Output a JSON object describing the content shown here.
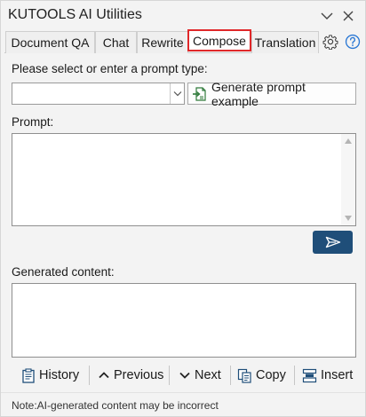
{
  "window": {
    "title": "KUTOOLS AI Utilities"
  },
  "tabs": [
    {
      "label": "Document QA",
      "active": false
    },
    {
      "label": "Chat",
      "active": false
    },
    {
      "label": "Rewrite",
      "active": false
    },
    {
      "label": "Compose",
      "active": true
    },
    {
      "label": "Translation",
      "active": false
    }
  ],
  "tab_icons": [
    "gear-icon",
    "help-icon"
  ],
  "prompt_type": {
    "label": "Please select or enter a prompt type:",
    "value": "",
    "generate_button": "Generate prompt example"
  },
  "prompt": {
    "label": "Prompt:",
    "value": ""
  },
  "generated": {
    "label": "Generated content:",
    "value": ""
  },
  "toolbar": {
    "history": "History",
    "previous": "Previous",
    "next": "Next",
    "copy": "Copy",
    "insert": "Insert"
  },
  "note": "Note:AI-generated content may be incorrect",
  "colors": {
    "accent": "#1f4e79",
    "active_tab_border": "#e0282a",
    "help_icon": "#2b78d4",
    "background": "#f3f3f3"
  }
}
